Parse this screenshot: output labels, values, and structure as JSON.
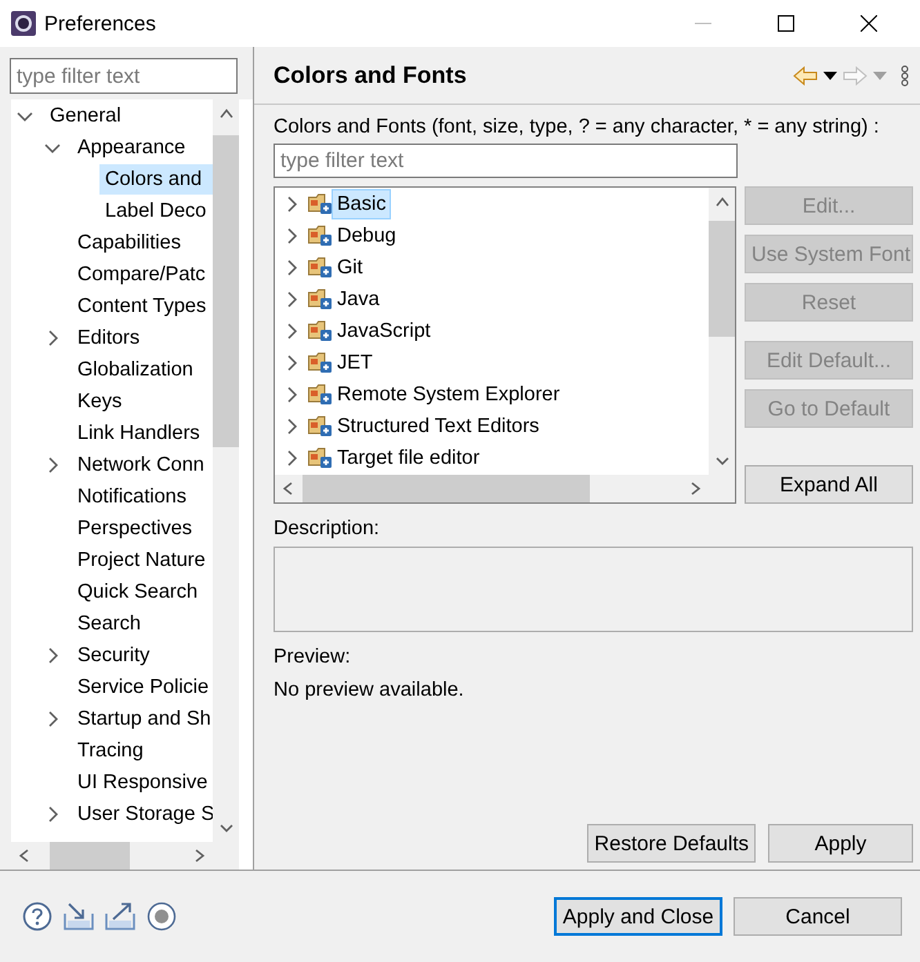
{
  "window": {
    "title": "Preferences"
  },
  "sidebar": {
    "filter": {
      "placeholder": "type filter text"
    },
    "tree": [
      {
        "label": "General",
        "expanded": true,
        "selected": false,
        "children": [
          {
            "label": "Appearance",
            "expanded": true,
            "selected": false,
            "children": [
              {
                "label": "Colors and",
                "selected": true
              },
              {
                "label": "Label Deco",
                "selected": false
              }
            ]
          },
          {
            "label": "Capabilities",
            "selected": false
          },
          {
            "label": "Compare/Patc",
            "selected": false
          },
          {
            "label": "Content Types",
            "selected": false
          },
          {
            "label": "Editors",
            "expanded": false,
            "selected": false
          },
          {
            "label": "Globalization",
            "selected": false
          },
          {
            "label": "Keys",
            "selected": false
          },
          {
            "label": "Link Handlers",
            "selected": false
          },
          {
            "label": "Network Conn",
            "expanded": false,
            "selected": false
          },
          {
            "label": "Notifications",
            "selected": false
          },
          {
            "label": "Perspectives",
            "selected": false
          },
          {
            "label": "Project Nature",
            "selected": false
          },
          {
            "label": "Quick Search",
            "selected": false
          },
          {
            "label": "Search",
            "selected": false
          },
          {
            "label": "Security",
            "expanded": false,
            "selected": false
          },
          {
            "label": "Service Policie",
            "selected": false
          },
          {
            "label": "Startup and Sh",
            "expanded": false,
            "selected": false
          },
          {
            "label": "Tracing",
            "selected": false
          },
          {
            "label": "UI Responsive",
            "selected": false
          },
          {
            "label": "User Storage S",
            "expanded": false,
            "selected": false
          }
        ]
      }
    ]
  },
  "page": {
    "title": "Colors and Fonts",
    "intro": "Colors and Fonts (font, size, type, ? = any character, * = any string) :",
    "filter": {
      "placeholder": "type filter text"
    },
    "tree": [
      {
        "label": "Basic",
        "expanded": false,
        "selected": true
      },
      {
        "label": "Debug",
        "expanded": false,
        "selected": false
      },
      {
        "label": "Git",
        "expanded": false,
        "selected": false
      },
      {
        "label": "Java",
        "expanded": false,
        "selected": false
      },
      {
        "label": "JavaScript",
        "expanded": false,
        "selected": false
      },
      {
        "label": "JET",
        "expanded": false,
        "selected": false
      },
      {
        "label": "Remote System Explorer",
        "expanded": false,
        "selected": false
      },
      {
        "label": "Structured Text Editors",
        "expanded": false,
        "selected": false
      },
      {
        "label": "Target file editor",
        "expanded": false,
        "selected": false
      }
    ],
    "button_groups": [
      [
        {
          "label": "Edit...",
          "disabled": true
        },
        {
          "label": "Use System Font",
          "disabled": true
        },
        {
          "label": "Reset",
          "disabled": true
        }
      ],
      [
        {
          "label": "Edit Default...",
          "disabled": true
        },
        {
          "label": "Go to Default",
          "disabled": true
        }
      ],
      [
        {
          "label": "Expand All",
          "disabled": false
        }
      ]
    ],
    "description_label": "Description:",
    "preview_label": "Preview:",
    "preview_text": "No preview available.",
    "buttons": [
      "Restore Defaults",
      "Apply"
    ]
  },
  "footer": {
    "buttons": [
      {
        "label": "Apply and Close",
        "default": true
      },
      {
        "label": "Cancel",
        "default": false
      }
    ]
  }
}
